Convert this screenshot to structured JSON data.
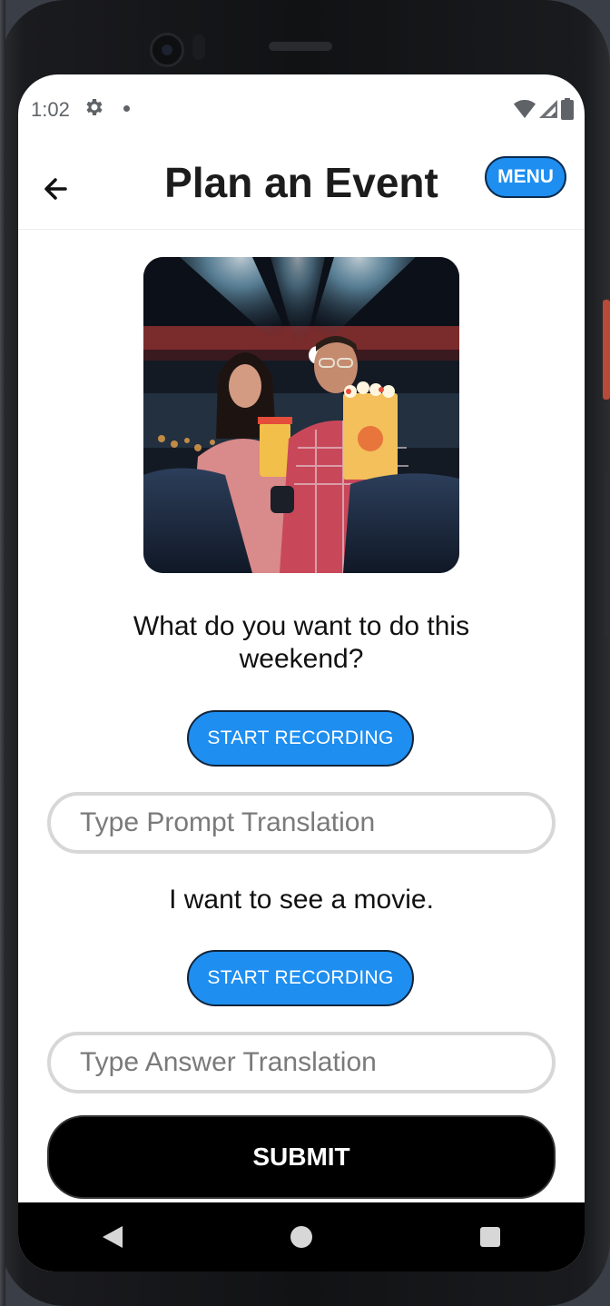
{
  "status_bar": {
    "time": "1:02"
  },
  "app_bar": {
    "title": "Plan an Event",
    "menu_label": "MENU"
  },
  "prompt": {
    "text": "What do you want to do this weekend?",
    "record_label": "START RECORDING",
    "translation_placeholder": "Type Prompt Translation"
  },
  "answer": {
    "text": "I want to see a movie.",
    "record_label": "START RECORDING",
    "translation_placeholder": "Type Answer Translation"
  },
  "submit_label": "SUBMIT",
  "colors": {
    "accent": "#1e8ef0",
    "submit": "#000000"
  },
  "icons": {
    "back": "arrow-left-icon",
    "settings": "gear-icon",
    "wifi": "wifi-icon",
    "signal": "signal-icon",
    "battery": "battery-icon",
    "nav_back": "triangle-back-icon",
    "nav_home": "circle-home-icon",
    "nav_recents": "square-recents-icon"
  }
}
